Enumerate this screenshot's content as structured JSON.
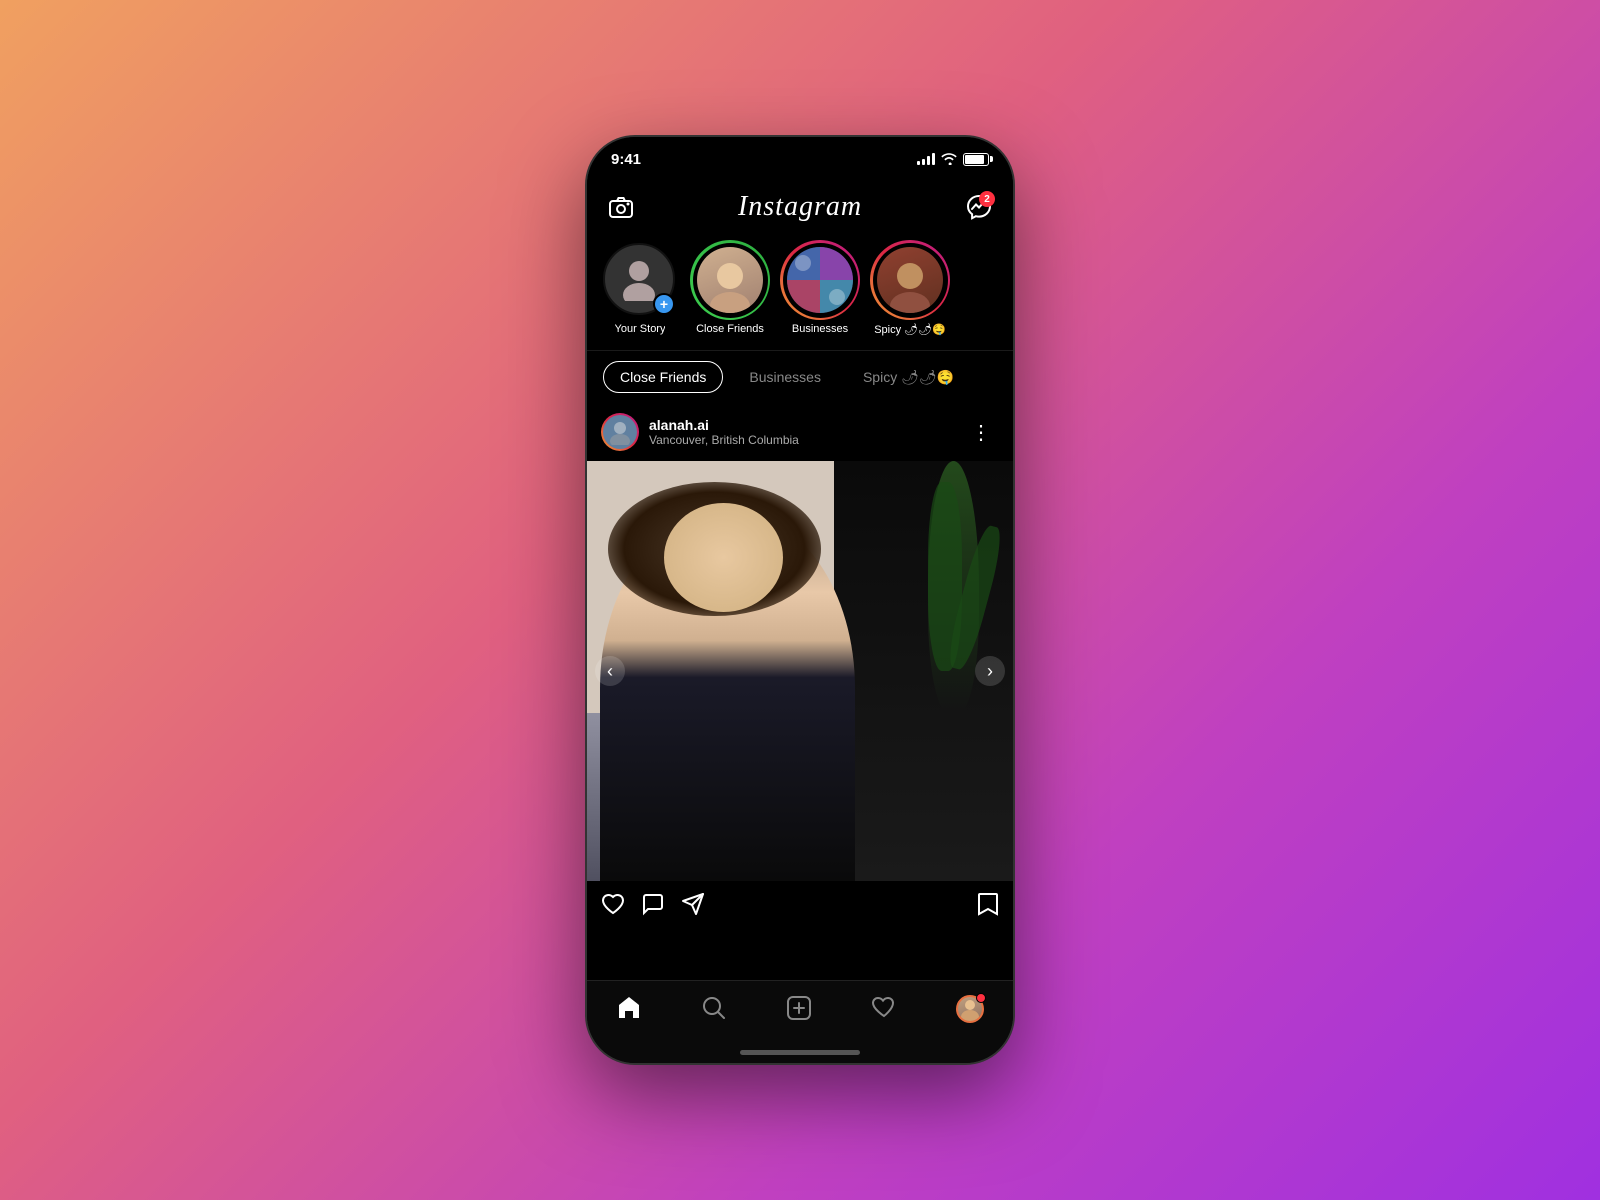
{
  "page": {
    "background": "gradient"
  },
  "statusBar": {
    "time": "9:41",
    "signalBars": 4,
    "wifiLabel": "wifi",
    "batteryLabel": "battery"
  },
  "header": {
    "cameraLabel": "camera",
    "logoText": "Instagram",
    "messengerLabel": "messenger",
    "messengerBadge": "2"
  },
  "stories": [
    {
      "id": "your-story",
      "label": "Your Story",
      "hasPlus": true,
      "ringType": "none",
      "avatarColor": "#806060"
    },
    {
      "id": "close-friends",
      "label": "Close Friends",
      "hasPlus": false,
      "ringType": "green",
      "avatarColor": "#c09070"
    },
    {
      "id": "businesses",
      "label": "Businesses",
      "hasPlus": false,
      "ringType": "gradient",
      "avatarColor": "#304080"
    },
    {
      "id": "spicy",
      "label": "Spicy 🌶🌶🤤",
      "hasPlus": false,
      "ringType": "gradient",
      "avatarColor": "#804020"
    }
  ],
  "filterTabs": [
    {
      "id": "close-friends-tab",
      "label": "Close Friends",
      "active": true
    },
    {
      "id": "businesses-tab",
      "label": "Businesses",
      "active": false
    },
    {
      "id": "spicy-tab",
      "label": "Spicy 🌶🌶🤤",
      "active": false
    }
  ],
  "post": {
    "username": "alanah.ai",
    "location": "Vancouver, British Columbia",
    "moreIcon": "⋮",
    "leftArrow": "‹",
    "rightArrow": "›"
  },
  "postActions": {
    "likeIcon": "♡",
    "commentIcon": "○",
    "shareIcon": "✈",
    "bookmarkIcon": "⊡"
  },
  "bottomNav": [
    {
      "id": "home",
      "icon": "⌂",
      "active": true
    },
    {
      "id": "search",
      "icon": "⌕",
      "active": false
    },
    {
      "id": "create",
      "icon": "⊕",
      "active": false
    },
    {
      "id": "activity",
      "icon": "♡",
      "active": false
    },
    {
      "id": "profile",
      "icon": "profile",
      "active": false
    }
  ],
  "homeIndicator": {
    "label": "home-indicator"
  }
}
